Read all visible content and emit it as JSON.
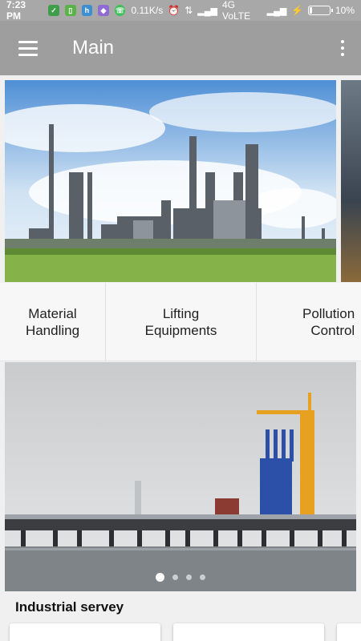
{
  "status_bar": {
    "time": "7:23 PM",
    "network_speed": "0.11K/s",
    "network": "4G VoLTE",
    "battery": "10%",
    "battery_level": 0.1,
    "notification_icons": [
      "shield-icon",
      "sim-icon",
      "app-icon",
      "app-icon",
      "whatsapp-icon"
    ]
  },
  "app_bar": {
    "title": "Main"
  },
  "categories": [
    {
      "label": "Material\nHandling"
    },
    {
      "label": "Lifting\nEquipments"
    },
    {
      "label": "Pollution\nControl"
    }
  ],
  "slider": {
    "page_count": 4,
    "active_page": 1
  },
  "section": {
    "title": "Industrial servey"
  }
}
